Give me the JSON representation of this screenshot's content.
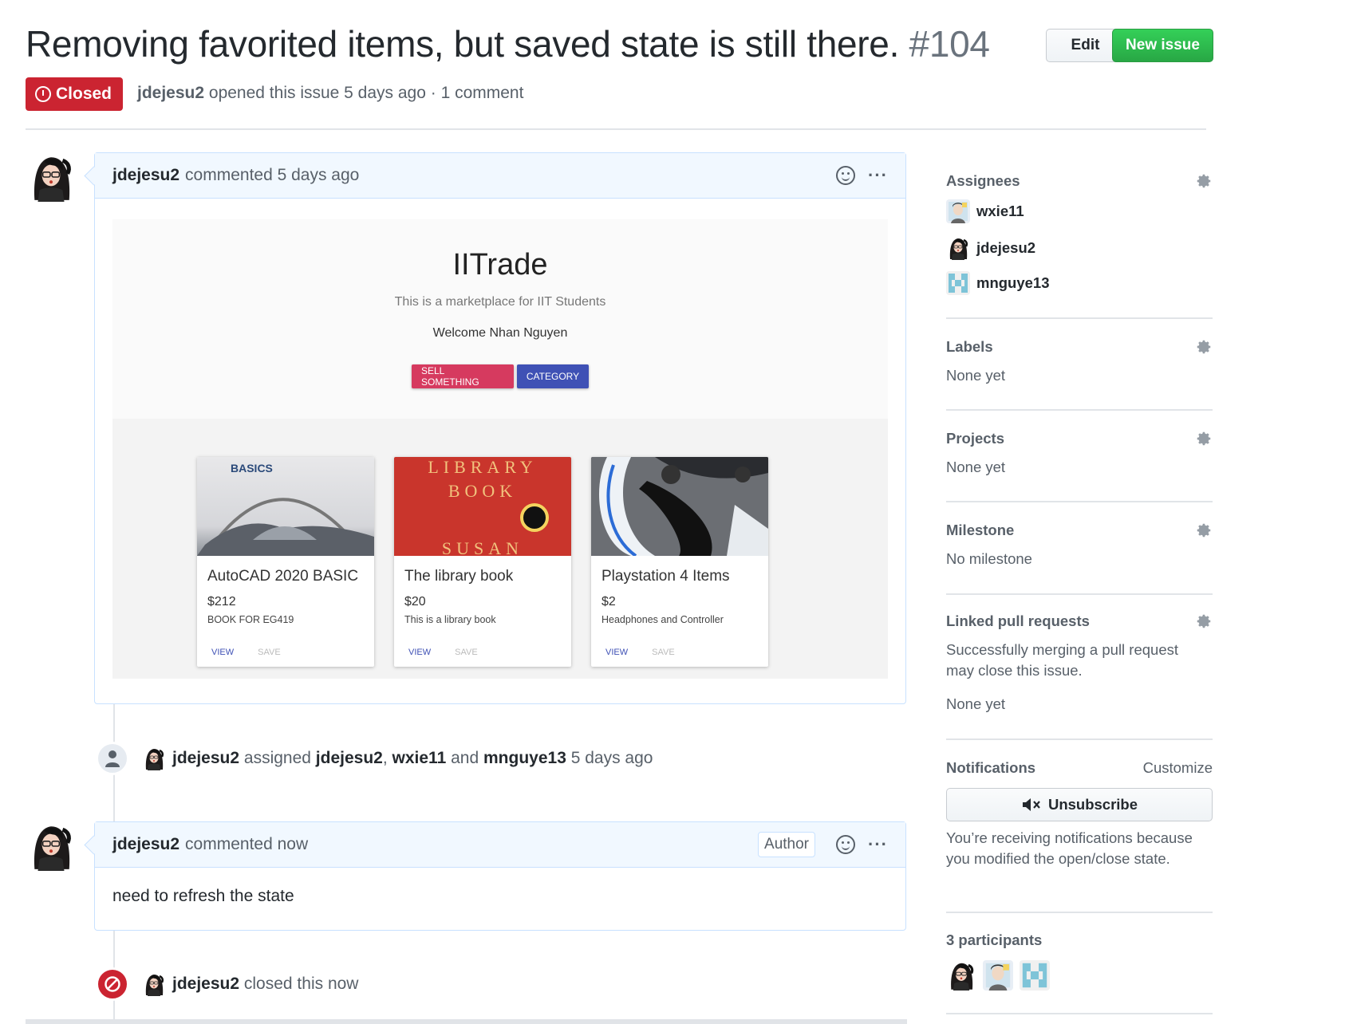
{
  "issue": {
    "title": "Removing favorited items, but saved state is still there.",
    "number": "#104",
    "edit_label": "Edit",
    "new_issue_label": "New issue",
    "state_label": "Closed",
    "author": "jdejesu2",
    "meta_text": "opened this issue 5 days ago · 1 comment"
  },
  "comment1": {
    "author": "jdejesu2",
    "action": "commented 5 days ago",
    "more": "···",
    "screenshot": {
      "app_title": "IITrade",
      "subtitle": "This is a marketplace for IIT Students",
      "welcome": "Welcome Nhan Nguyen",
      "sell_button": "SELL SOMETHING",
      "category_button": "CATEGORY",
      "cards": [
        {
          "title": "AutoCAD 2020 BASIC",
          "price": "$212",
          "desc": "BOOK FOR EG419",
          "view": "VIEW",
          "save": "SAVE",
          "img_text": "BASICS"
        },
        {
          "title": "The library book",
          "price": "$20",
          "desc": "This is a library book",
          "view": "VIEW",
          "save": "SAVE",
          "img_text1": "LIBRARY",
          "img_text2": "BOOK",
          "img_text3": "SUSAN"
        },
        {
          "title": "Playstation 4 Items",
          "price": "$2",
          "desc": "Headphones and Controller",
          "view": "VIEW",
          "save": "SAVE"
        }
      ]
    }
  },
  "event_assigned": {
    "actor": "jdejesu2",
    "verb": "assigned",
    "a1": "jdejesu2",
    "sep": ",",
    "a2": "wxie11",
    "and": "and",
    "a3": "mnguye13",
    "time": "5 days ago"
  },
  "comment2": {
    "author": "jdejesu2",
    "action": "commented now",
    "badge": "Author",
    "more": "···",
    "body": "need to refresh the state"
  },
  "event_closed": {
    "actor": "jdejesu2",
    "text": "closed this now"
  },
  "sidebar": {
    "assignees_title": "Assignees",
    "assignees": [
      "wxie11",
      "jdejesu2",
      "mnguye13"
    ],
    "labels_title": "Labels",
    "labels_value": "None yet",
    "projects_title": "Projects",
    "projects_value": "None yet",
    "milestone_title": "Milestone",
    "milestone_value": "No milestone",
    "linked_title": "Linked pull requests",
    "linked_desc": "Successfully merging a pull request may close this issue.",
    "linked_value": "None yet",
    "notifications_title": "Notifications",
    "customize": "Customize",
    "unsubscribe": "Unsubscribe",
    "notif_desc": "You’re receiving notifications because you modified the open/close state.",
    "participants_title": "3 participants"
  },
  "colors": {
    "closed_red": "#cb2431",
    "green": "#28a745",
    "comment_header": "#f1f8ff"
  }
}
